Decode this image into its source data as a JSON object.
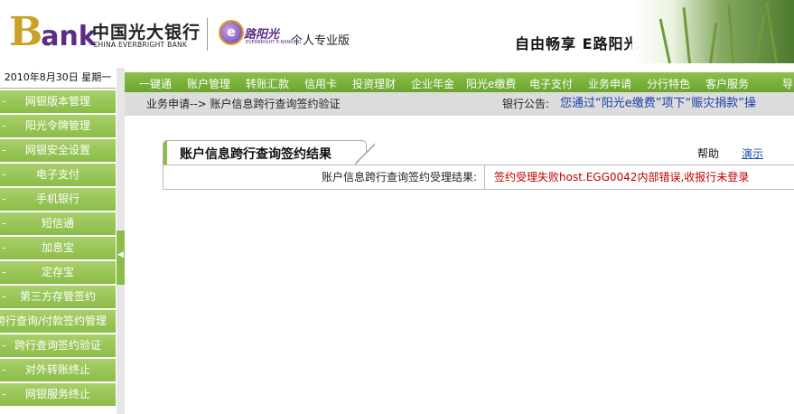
{
  "header": {
    "logo_b": "B",
    "logo_ank": "ank",
    "bank_name_cn": "中国光大银行",
    "bank_name_en": "CHINA EVERBRIGHT BANK",
    "eroad_badge": "e",
    "eroad_name": "路阳光",
    "eroad_sub": "EVERBRIGHT E-BANKING",
    "edition": "个人专业版",
    "slogan": "自由畅享  E路阳光"
  },
  "date": "2010年8月30日  星期一",
  "sidebar": {
    "items": [
      {
        "label": "网银版本管理"
      },
      {
        "label": "阳光令牌管理"
      },
      {
        "label": "网银安全设置"
      },
      {
        "label": "电子支付"
      },
      {
        "label": "手机银行"
      },
      {
        "label": "短信通"
      },
      {
        "label": "加息宝"
      },
      {
        "label": "定存宝"
      },
      {
        "label": "第三方存管签约"
      },
      {
        "label": "跨行查询/付款签约管理"
      },
      {
        "label": "跨行查询签约验证"
      },
      {
        "label": "对外转账终止"
      },
      {
        "label": "网银服务终止"
      }
    ],
    "dash": "-"
  },
  "topnav": {
    "items": [
      "一键通",
      "账户管理",
      "转账汇款",
      "信用卡",
      "投资理财",
      "企业年金",
      "阳光e缴费",
      "电子支付",
      "业务申请",
      "分行特色",
      "客户服务",
      "导"
    ]
  },
  "subbar": {
    "breadcrumb": "业务申请--> 账户信息跨行查询签约验证",
    "notice_label": "银行公告:",
    "notice_text": "您通过“阳光e缴费”项下“赈灾捐款”操"
  },
  "panel": {
    "title": "账户信息跨行查询签约结果",
    "help": "帮助",
    "demo": "演示",
    "result_label": "账户信息跨行查询签约受理结果:",
    "result_value": "签约受理失败host.EGG0042内部错误,收报行未登录"
  },
  "colors": {
    "accent_green": "#8bbd48",
    "error_red": "#c00000",
    "notice_blue": "#1a3fa8",
    "brand_purple": "#5b2d86"
  }
}
